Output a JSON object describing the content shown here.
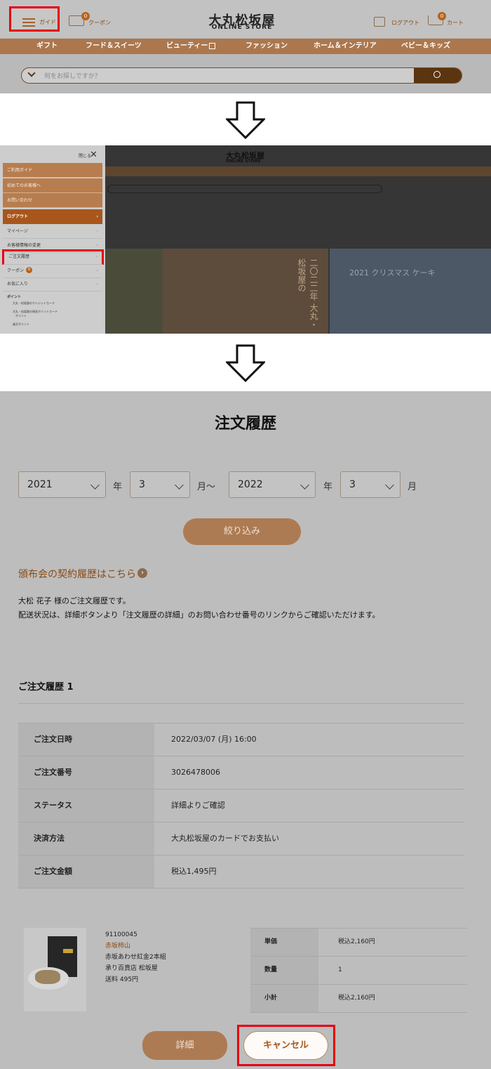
{
  "panel1": {
    "guide_label": "ガイド",
    "coupon_count": "0",
    "coupon_label": "クーポン",
    "logo_jp": "大丸松坂屋",
    "logo_en": "ONLINE STORE",
    "logout_label": "ログアウト",
    "cart_count": "0",
    "cart_label": "カート",
    "nav": [
      "ギフト",
      "フード＆スイーツ",
      "ビューティー",
      "ファッション",
      "ホーム＆インテリア",
      "ベビー＆キッズ"
    ],
    "search_placeholder": "何をお探しですか？"
  },
  "panel2": {
    "close_label": "閉じる",
    "menu": [
      "ご利用ガイド",
      "初めてのお客様へ",
      "お問い合わせ",
      "ログアウト",
      "マイページ",
      "お客様情報の変更",
      "ご注文履歴",
      "クーポン",
      "お気に入り",
      "ポイント",
      "大丸・松坂屋のクレジットカード",
      "大丸・松坂屋の現金ポイントカード",
      "ポイント",
      "楽天ポイント"
    ],
    "coupon_badge": "0",
    "bg_logo_jp": "大丸松坂屋",
    "bg_logo_en": "ONLINE STORE",
    "osechi_text": "二〇二二年 大丸・松坂屋の",
    "cake_text": "2021 クリスマス ケーキ"
  },
  "panel3": {
    "title": "注文履歴",
    "from_year": "2021",
    "year_label": "年",
    "from_month": "3",
    "month_tilde": "月～",
    "to_year": "2022",
    "to_month": "3",
    "month_label": "月",
    "filter_button": "絞り込み",
    "subscription_link": "頒布会の契約履歴はこちら",
    "intro_line1": "大松 花子 様のご注文履歴です。",
    "intro_line2": "配送状況は、詳細ボタンより「注文履歴の詳細」のお問い合わせ番号のリンクからご確認いただけます。",
    "history_heading": "ご注文履歴 1",
    "order_rows": [
      {
        "k": "ご注文日時",
        "v": "2022/03/07 (月) 16:00"
      },
      {
        "k": "ご注文番号",
        "v": "3026478006"
      },
      {
        "k": "ステータス",
        "v": "詳細よりご確認"
      },
      {
        "k": "決済方法",
        "v": "大丸松坂屋のカードでお支払い"
      },
      {
        "k": "ご注文金額",
        "v": "税込1,495円"
      }
    ],
    "item": {
      "code": "91100045",
      "brand": "赤坂柿山",
      "name": "赤坂あわせ紅金2本組",
      "store": "承り百貨店 松坂屋",
      "shipping": "送料 495円"
    },
    "item_rows": [
      {
        "k": "単価",
        "v": "税込2,160円"
      },
      {
        "k": "数量",
        "v": "1"
      },
      {
        "k": "小計",
        "v": "税込2,160円"
      }
    ],
    "detail_button": "詳細",
    "cancel_button": "キャンセル"
  }
}
